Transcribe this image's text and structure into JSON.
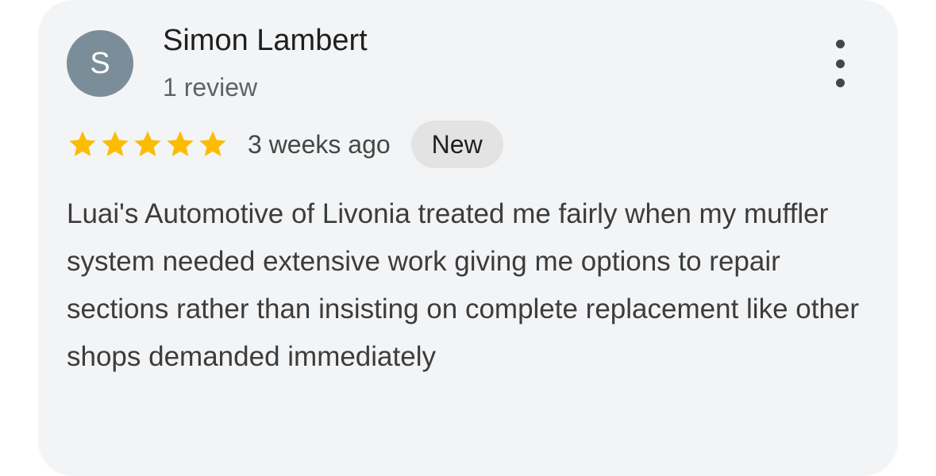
{
  "review": {
    "avatar_initial": "S",
    "reviewer_name": "Simon Lambert",
    "reviewer_review_count": "1 review",
    "rating": 5,
    "rating_max": 5,
    "time_ago": "3 weeks ago",
    "badge": "New",
    "text": "Luai's Automotive of Livonia treated me fairly when my muffler system needed extensive work giving me options to repair sections rather than insisting on complete replacement like other shops demanded immediately"
  },
  "icons": {
    "more_menu": "more-vert-icon",
    "star": "star-icon"
  },
  "colors": {
    "card_background": "#f3f4f6",
    "avatar_background": "#7b8d99",
    "star_fill": "#fbbc04",
    "badge_background": "#e3e3e3"
  }
}
